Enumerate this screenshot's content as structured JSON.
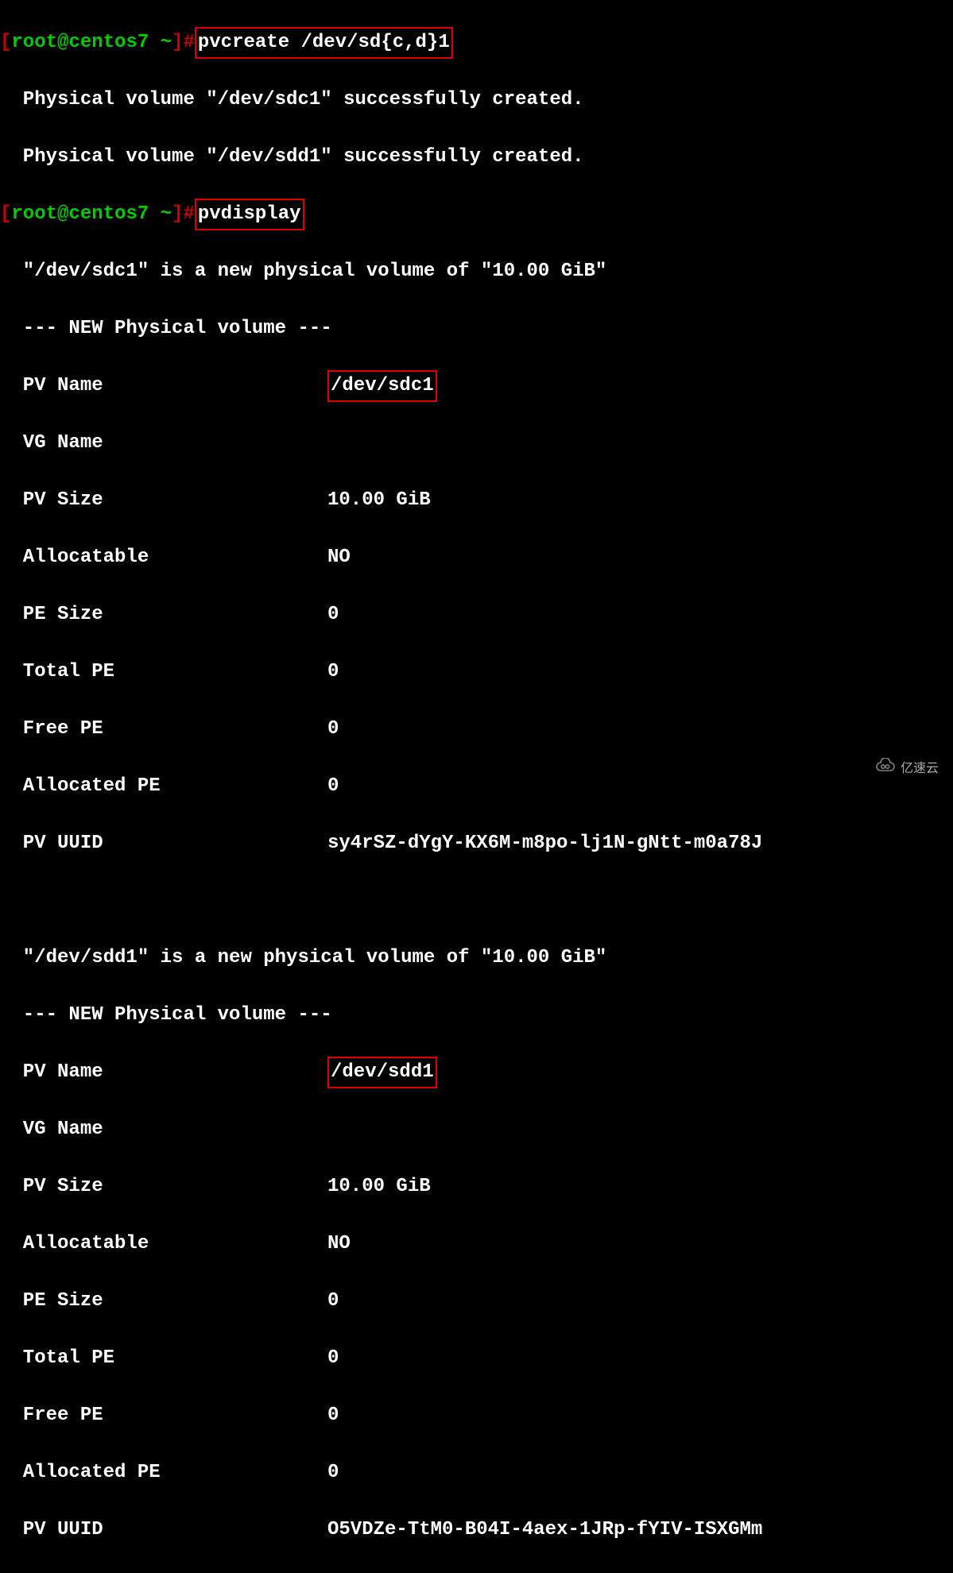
{
  "prompt": {
    "bracket_open": "[",
    "user": "root",
    "at": "@",
    "host": "centos7",
    "path": "~",
    "bracket_close": "]",
    "hash": "#"
  },
  "cmd": {
    "pvcreate": "pvcreate /dev/sd{c,d}1",
    "pvdisplay": "pvdisplay"
  },
  "out_create": {
    "line1": "  Physical volume \"/dev/sdc1\" successfully created.",
    "line2": "  Physical volume \"/dev/sdd1\" successfully created."
  },
  "pv1": {
    "header": "  \"/dev/sdc1\" is a new physical volume of \"10.00 GiB\"",
    "sep": "  --- NEW Physical volume ---",
    "k_name": "  PV Name",
    "v_name": "/dev/sdc1",
    "k_vg": "  VG Name",
    "v_vg": "",
    "k_size": "  PV Size",
    "v_size": "10.00 GiB",
    "k_alloc": "  Allocatable",
    "v_alloc": "NO",
    "k_pesz": "  PE Size",
    "v_pesz": "0",
    "k_totpe": "  Total PE",
    "v_totpe": "0",
    "k_freepe": "  Free PE",
    "v_freepe": "0",
    "k_allocpe": "  Allocated PE",
    "v_allocpe": "0",
    "k_uuid": "  PV UUID",
    "v_uuid": "sy4rSZ-dYgY-KX6M-m8po-lj1N-gNtt-m0a78J"
  },
  "pv2": {
    "header": "  \"/dev/sdd1\" is a new physical volume of \"10.00 GiB\"",
    "sep": "  --- NEW Physical volume ---",
    "k_name": "  PV Name",
    "v_name": "/dev/sdd1",
    "k_vg": "  VG Name",
    "v_vg": "",
    "k_size": "  PV Size",
    "v_size": "10.00 GiB",
    "k_alloc": "  Allocatable",
    "v_alloc": "NO",
    "k_pesz": "  PE Size",
    "v_pesz": "0",
    "k_totpe": "  Total PE",
    "v_totpe": "0",
    "k_freepe": "  Free PE",
    "v_freepe": "0",
    "k_allocpe": "  Allocated PE",
    "v_allocpe": "0",
    "k_uuid": "  PV UUID",
    "v_uuid": "O5VDZe-TtM0-B04I-4aex-1JRp-fYIV-ISXGMm"
  },
  "watermark": "亿速云"
}
